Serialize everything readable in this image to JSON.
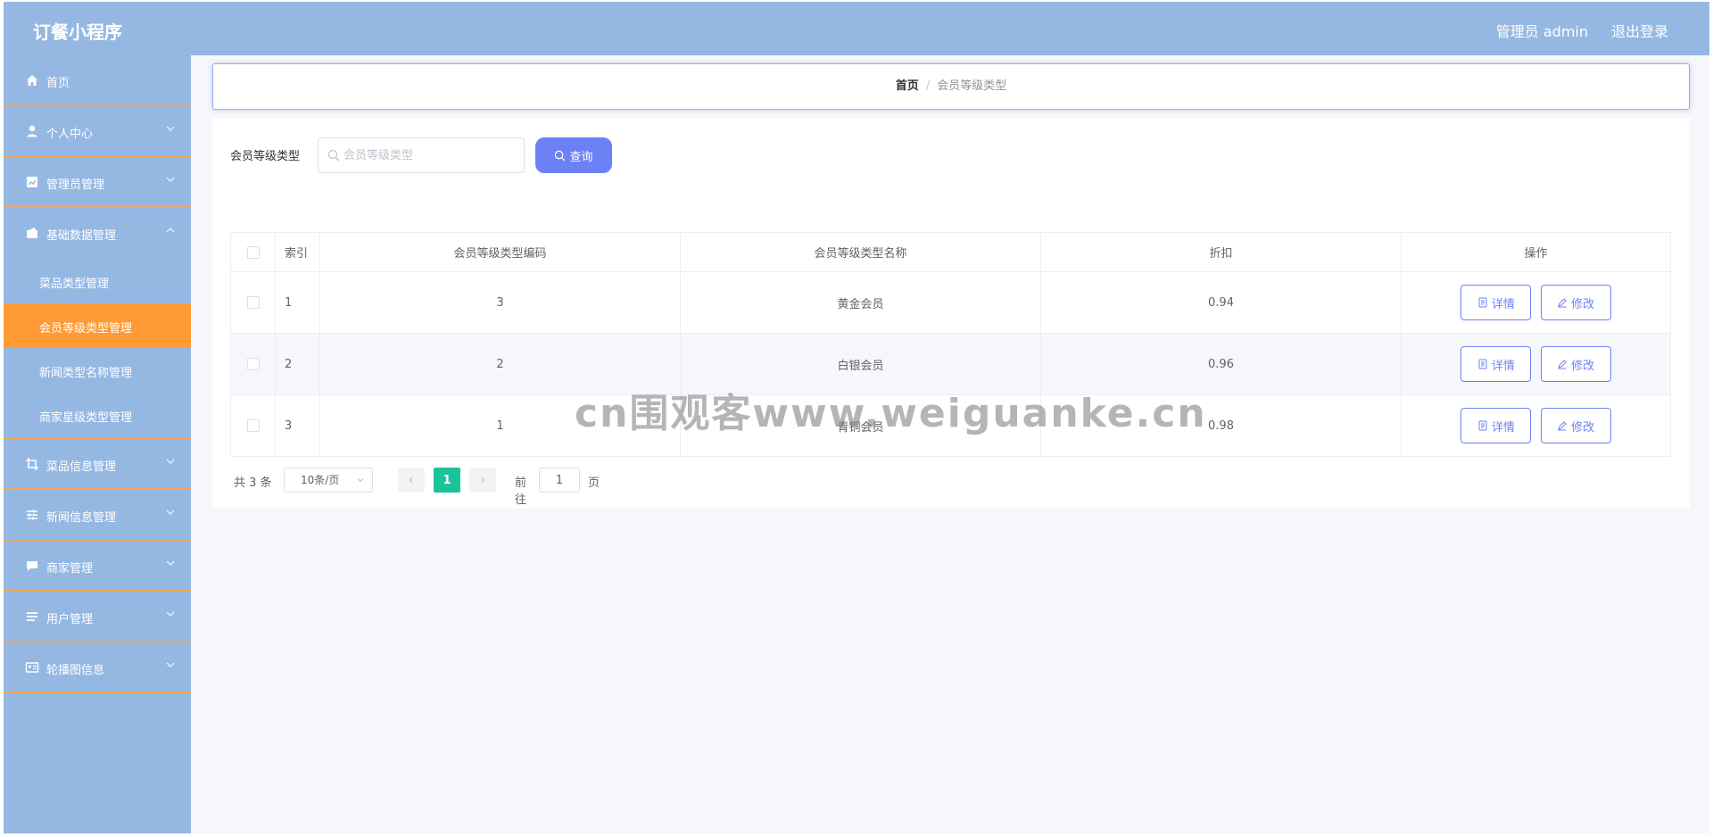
{
  "header": {
    "app_title": "订餐小程序",
    "user": "管理员 admin",
    "logout": "退出登录"
  },
  "sidebar": {
    "items": [
      {
        "label": "首页",
        "icon": "home-icon"
      },
      {
        "label": "个人中心",
        "icon": "user-icon"
      },
      {
        "label": "管理员管理",
        "icon": "chart-icon"
      },
      {
        "label": "基础数据管理",
        "icon": "wallet-icon",
        "expanded": true,
        "children": [
          {
            "label": "菜品类型管理"
          },
          {
            "label": "会员等级类型管理",
            "active": true
          },
          {
            "label": "新闻类型名称管理"
          },
          {
            "label": "商家星级类型管理"
          }
        ]
      },
      {
        "label": "菜品信息管理",
        "icon": "crop-icon"
      },
      {
        "label": "新闻信息管理",
        "icon": "sliders-icon"
      },
      {
        "label": "商家管理",
        "icon": "chat-icon"
      },
      {
        "label": "用户管理",
        "icon": "list-icon"
      },
      {
        "label": "轮播图信息",
        "icon": "id-card-icon"
      }
    ]
  },
  "breadcrumb": {
    "home": "首页",
    "separator": "/",
    "current": "会员等级类型"
  },
  "search": {
    "label": "会员等级类型",
    "placeholder": "会员等级类型",
    "value": "",
    "button": "查询"
  },
  "table": {
    "columns": [
      "索引",
      "会员等级类型编码",
      "会员等级类型名称",
      "折扣",
      "操作"
    ],
    "rows": [
      {
        "index": "1",
        "code": "3",
        "name": "黄金会员",
        "discount": "0.94"
      },
      {
        "index": "2",
        "code": "2",
        "name": "白银会员",
        "discount": "0.96"
      },
      {
        "index": "3",
        "code": "1",
        "name": "青铜会员",
        "discount": "0.98"
      }
    ],
    "detail_label": "详情",
    "edit_label": "修改"
  },
  "pagination": {
    "total": "共 3 条",
    "page_size": "10条/页",
    "current_page": "1",
    "goto": "前往",
    "goto_value": "1",
    "page_suffix": "页"
  },
  "watermark": "cn围观客www.weiguanke.cn",
  "colors": {
    "header": "#95b8e3",
    "active_menu": "#ff9a35",
    "primary": "#6c81f6",
    "page_active": "#1cc29a"
  }
}
